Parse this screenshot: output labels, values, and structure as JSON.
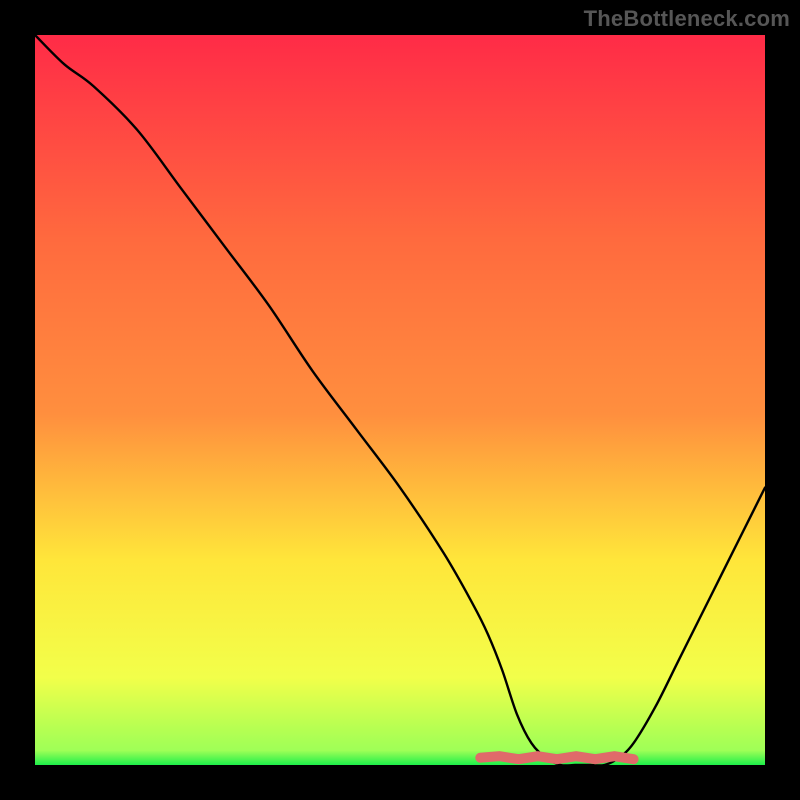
{
  "watermark": "TheBottleneck.com",
  "chart_data": {
    "type": "line",
    "title": "",
    "xlabel": "",
    "ylabel": "",
    "xlim": [
      0,
      100
    ],
    "ylim": [
      0,
      100
    ],
    "grid": false,
    "background_gradient": {
      "top": "#ff2b47",
      "mid_upper": "#ff8f3e",
      "mid": "#ffe63a",
      "mid_lower": "#f2ff4a",
      "near_bottom": "#9fff57",
      "bottom": "#1eef4a"
    },
    "series": [
      {
        "name": "bottleneck-curve",
        "color": "#000000",
        "x": [
          0,
          4,
          8,
          14,
          20,
          26,
          32,
          38,
          44,
          50,
          56,
          60,
          62,
          64,
          66,
          68,
          70,
          72,
          74,
          76,
          78,
          80,
          82,
          85,
          88,
          91,
          94,
          97,
          100
        ],
        "y": [
          100,
          96,
          93,
          87,
          79,
          71,
          63,
          54,
          46,
          38,
          29,
          22,
          18,
          13,
          7,
          3,
          1,
          0,
          0,
          0,
          0,
          1,
          3,
          8,
          14,
          20,
          26,
          32,
          38
        ]
      },
      {
        "name": "green-floor-band",
        "color": "#e06a6a",
        "type": "highlight",
        "x_range": [
          61,
          82
        ],
        "y": 1
      }
    ],
    "annotations": []
  }
}
